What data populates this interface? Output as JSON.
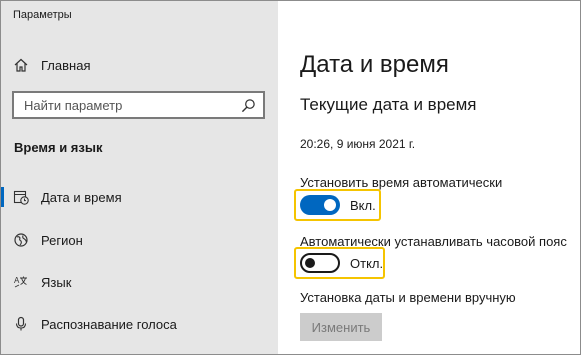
{
  "window": {
    "title": "Параметры"
  },
  "sidebar": {
    "home_label": "Главная",
    "search_placeholder": "Найти параметр",
    "section_title": "Время и язык",
    "items": [
      {
        "label": "Дата и время",
        "icon": "calendar-clock-icon",
        "active": true
      },
      {
        "label": "Регион",
        "icon": "globe-icon",
        "active": false
      },
      {
        "label": "Язык",
        "icon": "language-icon",
        "active": false
      },
      {
        "label": "Распознавание голоса",
        "icon": "microphone-icon",
        "active": false
      }
    ]
  },
  "main": {
    "title": "Дата и время",
    "subhead": "Текущие дата и время",
    "current_datetime": "20:26, 9 июня 2021 г.",
    "auto_time": {
      "label": "Установить время автоматически",
      "state": "Вкл.",
      "on": true
    },
    "auto_timezone": {
      "label": "Автоматически устанавливать часовой пояс",
      "state": "Откл.",
      "on": false
    },
    "manual": {
      "label": "Установка даты и времени вручную",
      "button": "Изменить"
    }
  },
  "colors": {
    "accent": "#0067c0",
    "highlight": "#f5c400",
    "sidebar_bg": "#e6e6e6"
  }
}
